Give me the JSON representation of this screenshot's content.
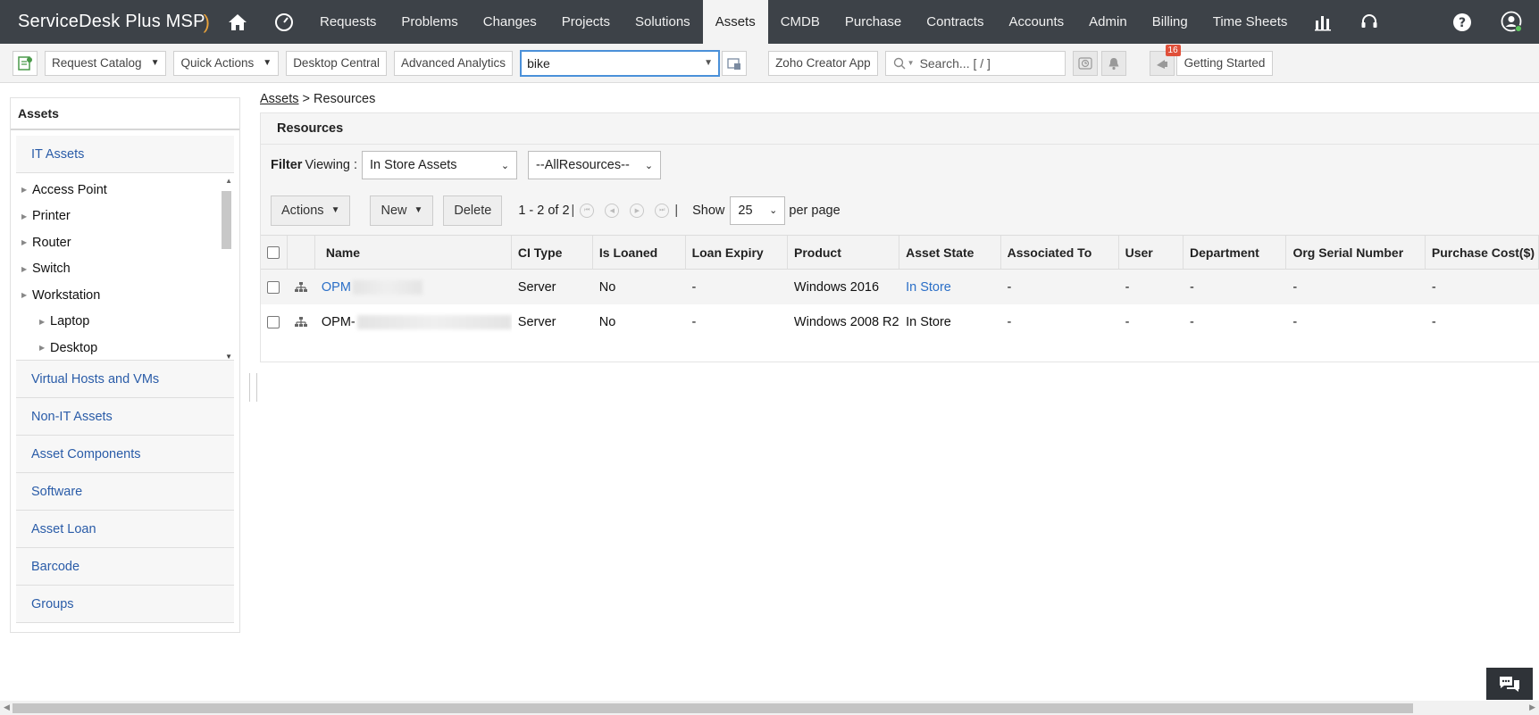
{
  "brand": {
    "name": "ServiceDesk Plus MSP"
  },
  "nav": {
    "items": [
      "Requests",
      "Problems",
      "Changes",
      "Projects",
      "Solutions",
      "Assets",
      "CMDB",
      "Purchase",
      "Contracts",
      "Accounts",
      "Admin",
      "Billing",
      "Time Sheets"
    ],
    "active": "Assets"
  },
  "toolbar": {
    "request_catalog": "Request Catalog",
    "quick_actions": "Quick Actions",
    "desktop_central": "Desktop Central",
    "advanced_analytics": "Advanced Analytics",
    "account_value": "bike",
    "zoho_creator": "Zoho Creator App",
    "search_placeholder": "Search... [ / ]",
    "notification_count": "16",
    "getting_started": "Getting Started"
  },
  "sidebar": {
    "header": "Assets",
    "it_assets": "IT Assets",
    "tree": [
      "Access Point",
      "Printer",
      "Router",
      "Switch",
      "Workstation",
      "Laptop",
      "Desktop"
    ],
    "categories": [
      "Virtual Hosts and VMs",
      "Non-IT Assets",
      "Asset Components",
      "Software",
      "Asset Loan",
      "Barcode",
      "Groups"
    ]
  },
  "breadcrumb": {
    "root": "Assets",
    "sep": " > ",
    "current": "Resources"
  },
  "panel": {
    "title": "Resources",
    "filter_label": "Filter",
    "viewing_label": "Viewing :",
    "view_value": "In Store Assets",
    "resource_value": "--AllResources--",
    "actions_label": "Actions",
    "new_label": "New",
    "delete_label": "Delete",
    "pager_text": "1 - 2 of 2",
    "show_label": "Show",
    "per_page_value": "25",
    "per_page_label": "per page"
  },
  "table": {
    "columns": [
      "Name",
      "CI Type",
      "Is Loaned",
      "Loan Expiry",
      "Product",
      "Asset State",
      "Associated To",
      "User",
      "Department",
      "Org Serial Number",
      "Purchase Cost($)"
    ],
    "rows": [
      {
        "name": "OPM",
        "ci_type": "Server",
        "is_loaned": "No",
        "loan_expiry": "-",
        "product": "Windows 2016",
        "asset_state": "In Store",
        "associated_to": "-",
        "user": "-",
        "department": "-",
        "org_serial": "-",
        "purchase_cost": "-"
      },
      {
        "name": "OPM-",
        "ci_type": "Server",
        "is_loaned": "No",
        "loan_expiry": "-",
        "product": "Windows 2008 R2",
        "asset_state": "In Store",
        "associated_to": "-",
        "user": "-",
        "department": "-",
        "org_serial": "-",
        "purchase_cost": "-"
      }
    ]
  },
  "colors": {
    "nav_bg": "#3d4248",
    "link": "#2b6fc7",
    "accent_border": "#4a90d9",
    "badge": "#e0503a"
  }
}
